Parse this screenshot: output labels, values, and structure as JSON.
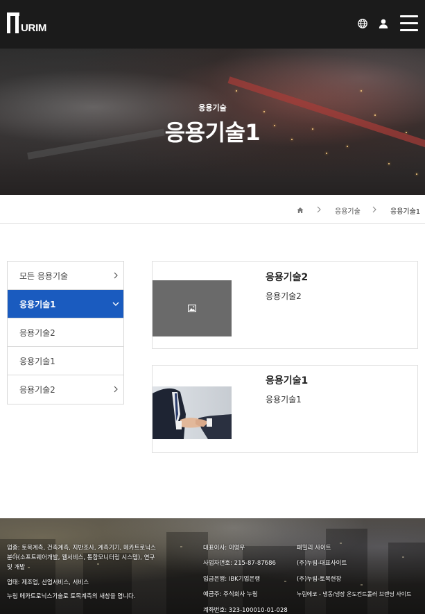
{
  "header": {
    "logo_text": "URIM",
    "icons": {
      "globe": "globe-icon",
      "user": "user-icon",
      "menu": "hamburger-menu-icon"
    },
    "brand_color": "#1b1b1b"
  },
  "hero": {
    "subtitle": "응용기술",
    "title": "응용기술1"
  },
  "breadcrumb": {
    "home_icon": "home-icon",
    "items": [
      "응용기술",
      "응용기술1"
    ]
  },
  "sidebar": {
    "accent_color": "#1a5bbf",
    "items": [
      {
        "label": "모든 응용기술",
        "state": "collapsed-arrow"
      },
      {
        "label": "응용기술1",
        "state": "active-expanded"
      },
      {
        "label": "응용기술2",
        "state": "sub"
      },
      {
        "label": "응용기술1",
        "state": "sub"
      },
      {
        "label": "응용기술2",
        "state": "collapsed-arrow"
      }
    ]
  },
  "cards": [
    {
      "title": "응용기술2",
      "desc": "응용기술2",
      "thumb": "placeholder-image-icon"
    },
    {
      "title": "응용기술1",
      "desc": "응용기술1",
      "thumb": "handshake-photo"
    }
  ],
  "footer": {
    "col1": [
      "업종: 토목계측, 건축계측, 지반조사, 계측기기, 메카트로닉스",
      "분야(소프트웨어개발, 웹서비스, 통합모니터링 시스템), 연구",
      "및 개발",
      "업태: 제조업, 산업서비스, 서비스",
      "누림 메카트로닉스기술로 토목계측의 새창을 엽니다."
    ],
    "col2": [
      "대표이사: 이영우",
      "사업자번호: 215-87-87686",
      "입금은행: IBK기업은행",
      "예금주: 주식회사 누림",
      "계좌번호: 323-100010-01-028"
    ],
    "col3": [
      "패밀리 사이트",
      "(주)누림-대표사이트",
      "(주)누림-토목현장",
      "누림에코 - 냉동/냉장 온도컨트롤러 브랜딩 사이트"
    ]
  }
}
